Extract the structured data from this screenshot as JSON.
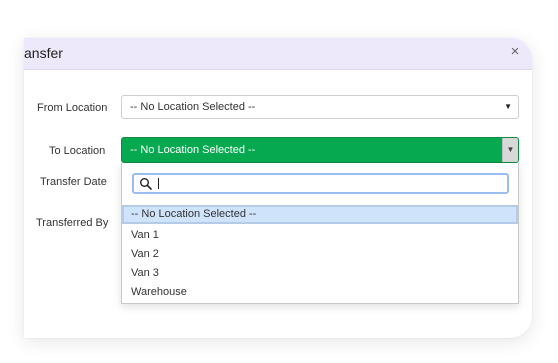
{
  "modal": {
    "title": "ansfer",
    "close_icon": "close-icon"
  },
  "form": {
    "from_location": {
      "label": "From Location",
      "value": "-- No Location Selected --"
    },
    "to_location": {
      "label": "To Location",
      "value": "-- No Location Selected --"
    },
    "transfer_date": {
      "label": "Transfer Date"
    },
    "transferred_by": {
      "label": "Transferred By"
    }
  },
  "dropdown": {
    "search_value": "",
    "search_icon": "search-icon",
    "options": [
      "-- No Location Selected --",
      "Van 1",
      "Van 2",
      "Van 3",
      "Warehouse"
    ],
    "selected_index": 0
  },
  "colors": {
    "header_bg": "#ede9fb",
    "active_select": "#06a94f",
    "selected_option_bg": "#cfe3fb",
    "search_border": "#9bbcf1"
  }
}
